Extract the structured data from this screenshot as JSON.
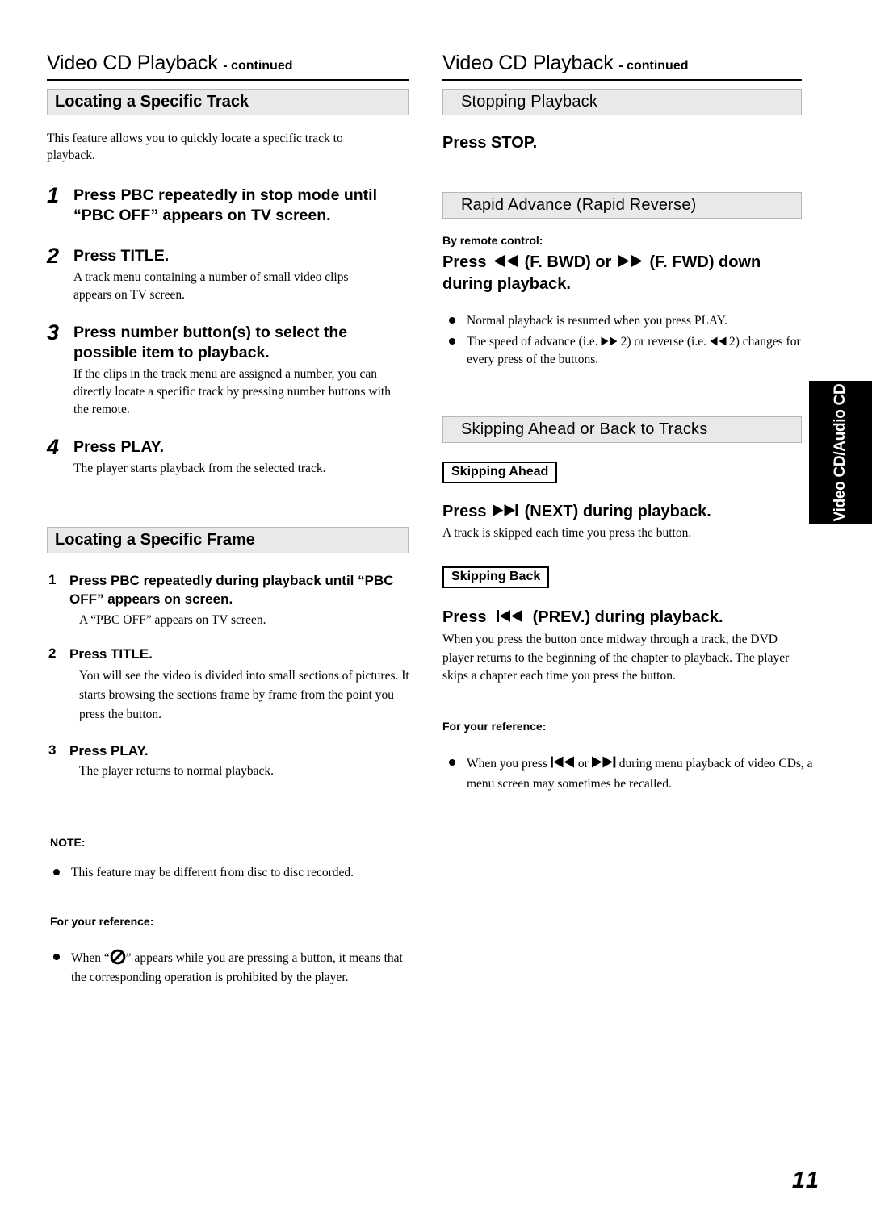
{
  "document": {
    "page_number": "11",
    "side_tab_label": "Video CD/Audio CD",
    "title_main": "Video CD Playback",
    "title_suffix": "- continued"
  },
  "left_column": {
    "title_main": "Video CD Playback",
    "title_suffix": "- continued",
    "section_track": {
      "heading": "Locating a Specific Track",
      "intro": "This feature allows you to quickly locate a specific track to playback.",
      "steps": [
        {
          "num": "1",
          "head": "Press PBC repeatedly in stop mode until “PBC OFF” appears on TV screen.",
          "desc": ""
        },
        {
          "num": "2",
          "head": "Press TITLE.",
          "desc": "A track menu containing a number of small video clips appears on TV screen."
        },
        {
          "num": "3",
          "head": "Press number button(s) to select the possible item to playback.",
          "desc": "If the clips in the track menu are assigned a number, you can directly locate a specific track by pressing number buttons with the remote."
        },
        {
          "num": "4",
          "head": "Press PLAY.",
          "desc": "The player starts playback from the selected track."
        }
      ]
    },
    "section_frame": {
      "heading": "Locating a Specific Frame",
      "steps": [
        {
          "num": "1",
          "head": "Press PBC repeatedly during playback until “PBC OFF” appears on screen.",
          "desc": "A “PBC OFF” appears on TV screen."
        },
        {
          "num": "2",
          "head": "Press TITLE.",
          "desc": "You will see the video is divided into small sections of pictures. It starts browsing the sections frame by frame from the point you press the button."
        },
        {
          "num": "3",
          "head": "Press PLAY.",
          "desc": "The player returns to normal playback."
        }
      ]
    },
    "note": {
      "label": "NOTE:",
      "bullets": [
        "This feature may be different from disc to disc recorded."
      ]
    },
    "reference": {
      "label": "For your reference:",
      "bullet_part1": "When “",
      "bullet_icon": "prohibited-icon",
      "bullet_part2": "” appears while you are pressing a button, it means that the corresponding operation is prohibited by the player."
    }
  },
  "right_column": {
    "title_main": "Video CD Playback",
    "title_suffix": "- continued",
    "section_stopping": {
      "heading": "Stopping Playback",
      "press_line": "Press STOP."
    },
    "section_rapid": {
      "heading": "Rapid Advance (Rapid Reverse)",
      "by_remote_label": "By remote control:",
      "press_prefix": "Press",
      "press_fbwd_icon": "rewind-icon",
      "press_fbwd_label": "(F. BWD) or",
      "press_ffwd_icon": "fast-forward-icon",
      "press_ffwd_label": "(F. FWD)  down during playback.",
      "bullets": [
        "Normal playback is resumed when you press PLAY.",
        "The speed of advance (i.e. ▶▶ 2) or reverse (i.e. ◀◀ 2) changes for every press of the  buttons."
      ],
      "bullet2_part1": "The speed of advance (i.e.",
      "bullet2_part2": "2) or reverse (i.e.",
      "bullet2_part3": "2) changes for every press of the  buttons."
    },
    "section_skipping": {
      "heading": "Skipping Ahead or Back to Tracks",
      "ahead": {
        "boxed_label": "Skipping Ahead",
        "press_prefix": "Press",
        "press_icon": "next-track-icon",
        "press_suffix": "(NEXT) during playback.",
        "desc": "A track is skipped each time you press the button."
      },
      "back": {
        "boxed_label": "Skipping Back",
        "press_prefix": "Press",
        "press_icon": "previous-track-icon",
        "press_suffix": "(PREV.) during playback.",
        "desc": "When you press the button once midway through a track, the DVD player returns to the beginning of the chapter to playback. The player skips a chapter each time you press the button."
      },
      "reference": {
        "label": "For your reference:",
        "bullet_part1": "When you press",
        "bullet_icon_prev": "previous-track-icon",
        "bullet_mid": "or",
        "bullet_icon_next": "next-track-icon",
        "bullet_part2": "during menu playback of video CDs, a menu screen may sometimes be recalled."
      }
    }
  },
  "colors": {
    "section_bar_bg": "#e9e9e9",
    "section_bar_border": "#b8b8b8",
    "side_tab_bg": "#000000",
    "side_tab_text": "#ffffff",
    "text": "#000000",
    "page_bg": "#ffffff"
  }
}
